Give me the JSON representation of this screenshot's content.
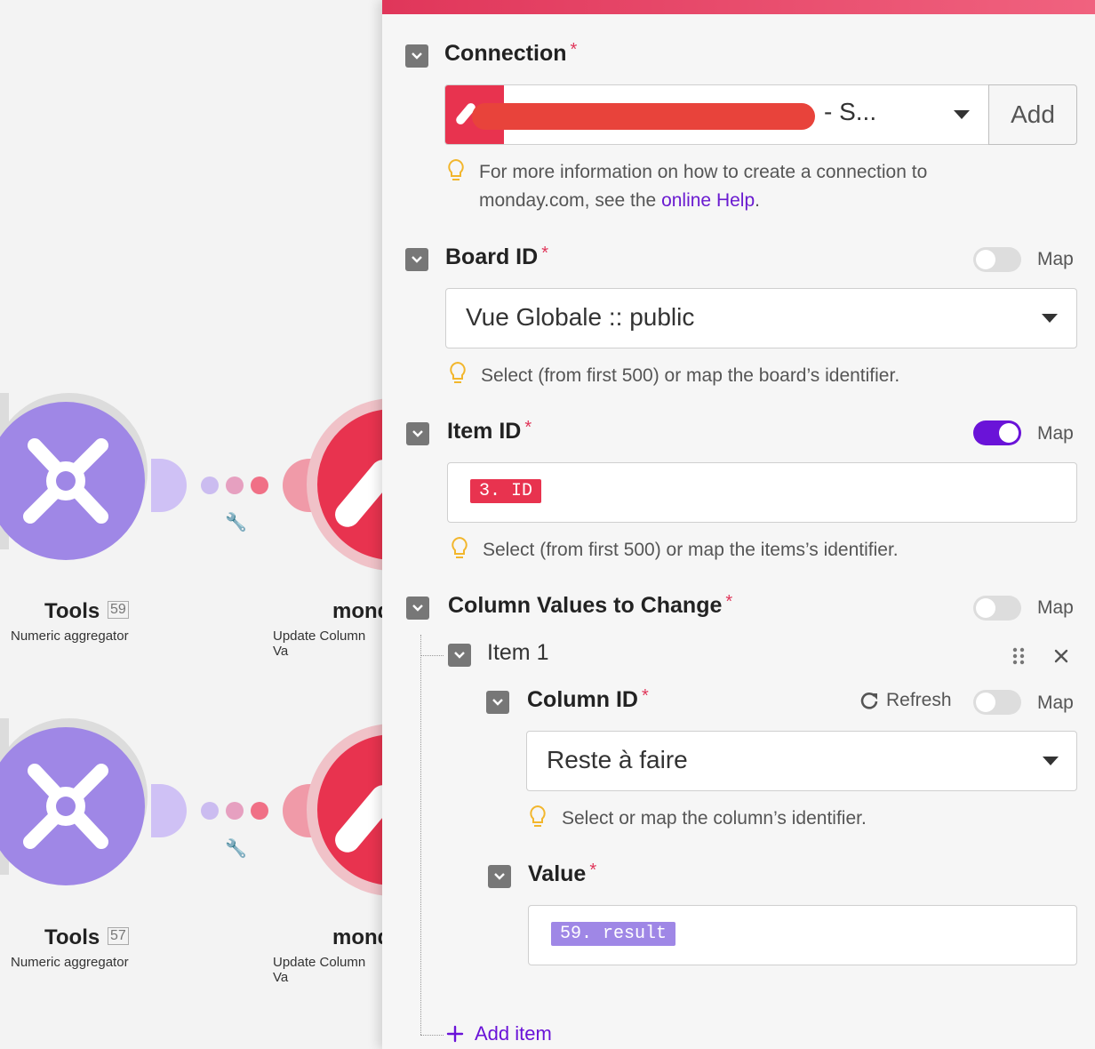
{
  "canvas": {
    "nodes": [
      {
        "title": "Tools",
        "number": "59",
        "subtitle": "Numeric aggregator",
        "target_title": "mond",
        "target_subtitle": "Update Column Va"
      },
      {
        "title": "Tools",
        "number": "57",
        "subtitle": "Numeric aggregator",
        "target_title": "mond",
        "target_subtitle": "Update Column Va"
      }
    ]
  },
  "panel": {
    "connection": {
      "label": "Connection",
      "required": "*",
      "value": "- S...",
      "add_label": "Add",
      "hint_prefix": "For more information on how to create a connection to monday.com, see the ",
      "hint_link": "online Help",
      "hint_suffix": "."
    },
    "board": {
      "label": "Board ID",
      "required": "*",
      "map_label": "Map",
      "map_on": false,
      "value": "Vue Globale :: public",
      "hint": "Select (from first 500) or map the board’s identifier."
    },
    "item": {
      "label": "Item ID",
      "required": "*",
      "map_label": "Map",
      "map_on": true,
      "pill": "3. ID",
      "hint": "Select (from first 500) or map the items’s identifier."
    },
    "columns": {
      "label": "Column Values to Change",
      "required": "*",
      "map_label": "Map",
      "map_on": false,
      "item_label": "Item 1",
      "column_id": {
        "label": "Column ID",
        "required": "*",
        "refresh_label": "Refresh",
        "map_label": "Map",
        "value": "Reste à faire",
        "hint": "Select or map the column’s identifier."
      },
      "value": {
        "label": "Value",
        "required": "*",
        "pill": "59. result"
      },
      "add_item_label": "Add item"
    },
    "colors": {
      "accent": "#6a13d8",
      "required": "#e0365a",
      "pill_red": "#e8334f",
      "pill_purple": "#9f87e6"
    }
  }
}
